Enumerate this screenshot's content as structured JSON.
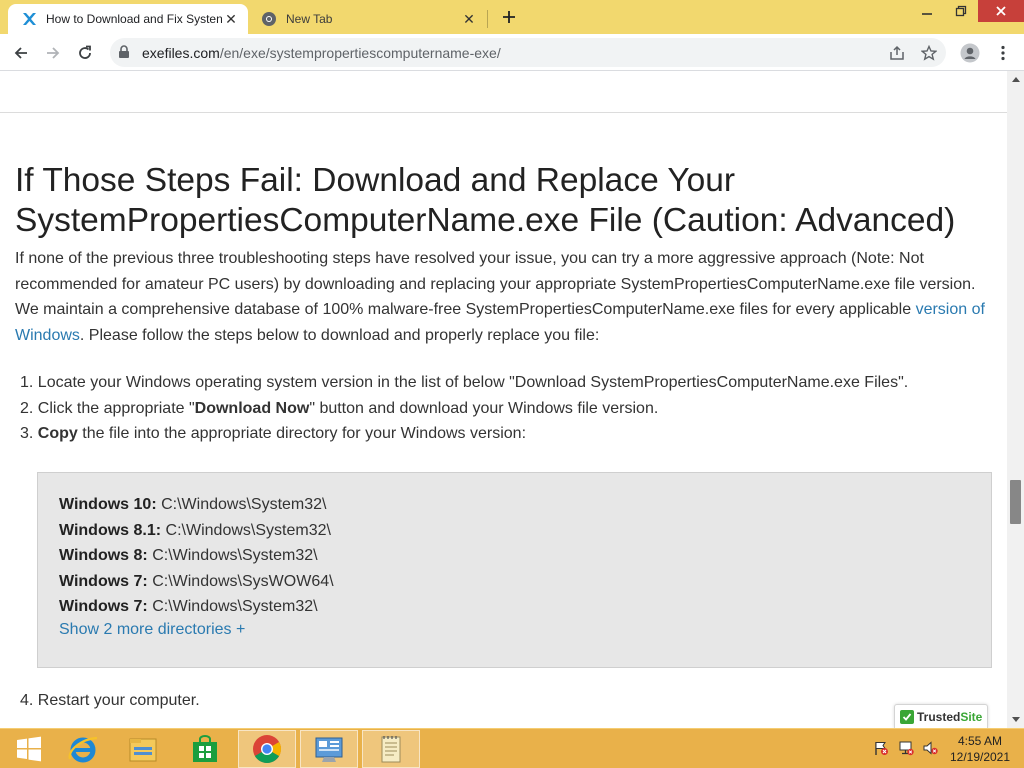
{
  "browser": {
    "tabs": [
      {
        "title": "How to Download and Fix Systen",
        "active": true
      },
      {
        "title": "New Tab",
        "active": false
      }
    ],
    "url_domain": "exefiles.com",
    "url_path": "/en/exe/systempropertiescomputername-exe/"
  },
  "article": {
    "heading": "If Those Steps Fail: Download and Replace Your SystemPropertiesComputerName.exe File (Caution: Advanced)",
    "intro_text": "If none of the previous three troubleshooting steps have resolved your issue, you can try a more aggressive approach (Note: Not recommended for amateur PC users) by downloading and replacing your appropriate SystemPropertiesComputerName.exe file version. We maintain a comprehensive database of 100% malware-free SystemPropertiesComputerName.exe files for every applicable ",
    "intro_link": "version of Windows",
    "intro_tail": ". Please follow the steps below to download and properly replace you file:",
    "steps": {
      "s1": "1. Locate your Windows operating system version in the list of below \"Download SystemPropertiesComputerName.exe Files\".",
      "s2_pre": "2. Click the appropriate \"",
      "s2_bold": "Download Now",
      "s2_post": "\" button and download your Windows file version.",
      "s3_pre": "3. ",
      "s3_bold": "Copy",
      "s3_post": " the file into the appropriate directory for your Windows version:"
    },
    "directories": [
      {
        "os": "Windows 10:",
        "path": "C:\\Windows\\System32\\"
      },
      {
        "os": "Windows 8.1:",
        "path": "C:\\Windows\\System32\\"
      },
      {
        "os": "Windows 8:",
        "path": "C:\\Windows\\System32\\"
      },
      {
        "os": "Windows 7:",
        "path": "C:\\Windows\\SysWOW64\\"
      },
      {
        "os": "Windows 7:",
        "path": "C:\\Windows\\System32\\"
      }
    ],
    "show_more": "Show 2 more directories +",
    "step4": "4. Restart your computer."
  },
  "badge": {
    "trusted": "Trusted",
    "site": "Site"
  },
  "clock": {
    "time": "4:55 AM",
    "date": "12/19/2021"
  },
  "colors": {
    "tabstrip": "#f2d86e",
    "taskbar": "#e9b14a",
    "link": "#2a7ab0",
    "dirbox": "#e7e7e7",
    "close": "#c7403a"
  }
}
